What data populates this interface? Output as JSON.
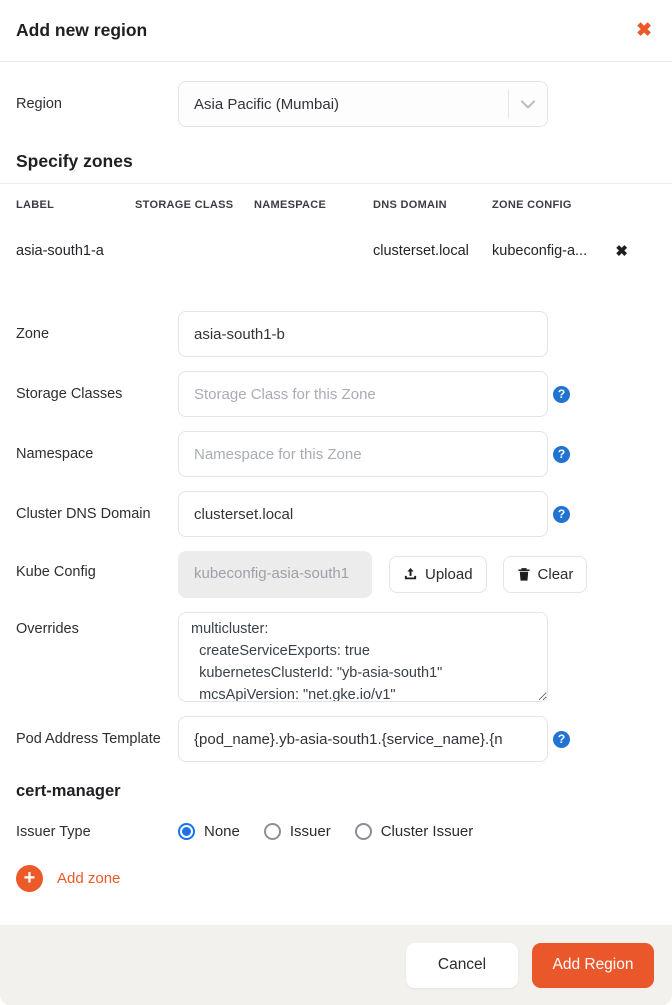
{
  "modal": {
    "title": "Add new region"
  },
  "icons": {
    "close": "✖",
    "remove": "✖",
    "plus": "+",
    "help": "?"
  },
  "region": {
    "label": "Region",
    "value": "Asia Pacific (Mumbai)"
  },
  "zones_section": {
    "heading": "Specify zones",
    "table": {
      "headers": [
        "LABEL",
        "STORAGE CLASS",
        "NAMESPACE",
        "DNS DOMAIN",
        "ZONE CONFIG"
      ],
      "rows": [
        {
          "label": "asia-south1-a",
          "storage_class": "",
          "namespace": "",
          "dns_domain": "clusterset.local",
          "zone_config": "kubeconfig-a..."
        }
      ]
    }
  },
  "form": {
    "zone": {
      "label": "Zone",
      "value": "asia-south1-b"
    },
    "storage_classes": {
      "label": "Storage Classes",
      "placeholder": "Storage Class for this Zone"
    },
    "namespace": {
      "label": "Namespace",
      "placeholder": "Namespace for this Zone"
    },
    "dns_domain": {
      "label": "Cluster DNS Domain",
      "value": "clusterset.local"
    },
    "kube_config": {
      "label": "Kube Config",
      "value": "kubeconfig-asia-south1",
      "upload_label": "Upload",
      "clear_label": "Clear"
    },
    "overrides": {
      "label": "Overrides",
      "value": "multicluster:\n  createServiceExports: true\n  kubernetesClusterId: \"yb-asia-south1\"\n  mcsApiVersion: \"net.gke.io/v1\""
    },
    "pod_address_template": {
      "label": "Pod Address Template",
      "value": "{pod_name}.yb-asia-south1.{service_name}.{n"
    }
  },
  "cert_manager": {
    "heading": "cert-manager",
    "issuer_type": {
      "label": "Issuer Type",
      "options": [
        "None",
        "Issuer",
        "Cluster Issuer"
      ],
      "selected": "None"
    }
  },
  "add_zone_label": "Add zone",
  "footer": {
    "cancel_label": "Cancel",
    "submit_label": "Add Region"
  },
  "colors": {
    "accent_orange": "#eb5a28",
    "help_blue": "#2173d2",
    "radio_blue": "#1a73e8",
    "footer_bg": "#f2f1ed"
  }
}
